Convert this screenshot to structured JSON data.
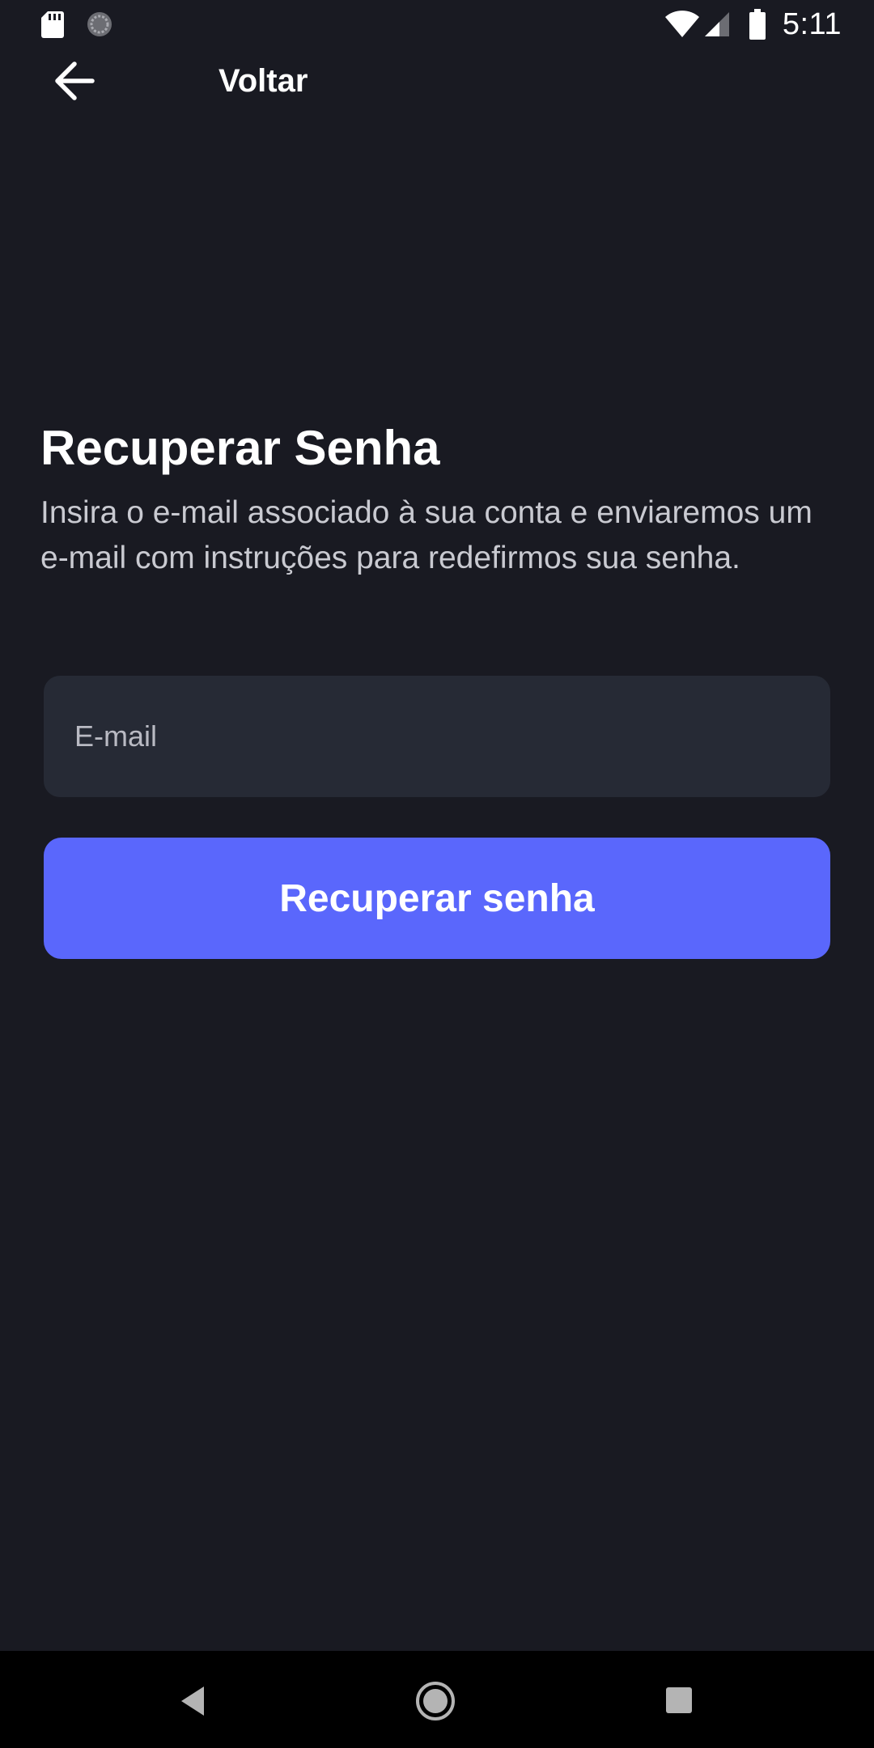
{
  "status_bar": {
    "time": "5:11",
    "icons": [
      "sd-card-icon",
      "sync-icon",
      "wifi-icon",
      "cell-signal-icon",
      "battery-icon"
    ]
  },
  "top_bar": {
    "back_icon": "arrow-left-icon",
    "title": "Voltar"
  },
  "main": {
    "title": "Recuperar Senha",
    "description": "Insira o e-mail associado à sua conta e enviaremos um e-mail com instruções para redefirmos sua senha.",
    "email_placeholder": "E-mail",
    "email_value": "",
    "submit_label": "Recuperar senha"
  },
  "nav_bar": {
    "icons": [
      "nav-back-icon",
      "nav-home-icon",
      "nav-recents-icon"
    ]
  },
  "colors": {
    "background": "#191a22",
    "input_background": "#262a35",
    "accent": "#5a67fc",
    "text_primary": "#ffffff",
    "text_secondary": "#c9cad1"
  }
}
